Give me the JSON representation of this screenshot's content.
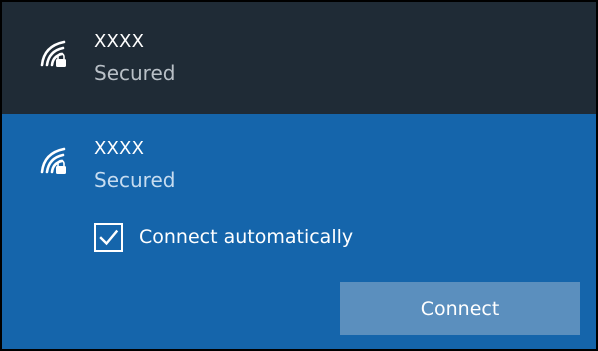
{
  "networks": [
    {
      "name": "XXXX",
      "status": "Secured",
      "icon": "wifi-secured-icon"
    },
    {
      "name": "XXXX",
      "status": "Secured",
      "icon": "wifi-secured-icon",
      "connect_automatically": {
        "label": "Connect automatically",
        "checked": true
      },
      "connect_button_label": "Connect"
    }
  ],
  "colors": {
    "dark_row_bg": "#1f2b36",
    "selected_row_bg": "#1565ab",
    "button_bg": "#5b8fbe",
    "text": "#ffffff"
  }
}
